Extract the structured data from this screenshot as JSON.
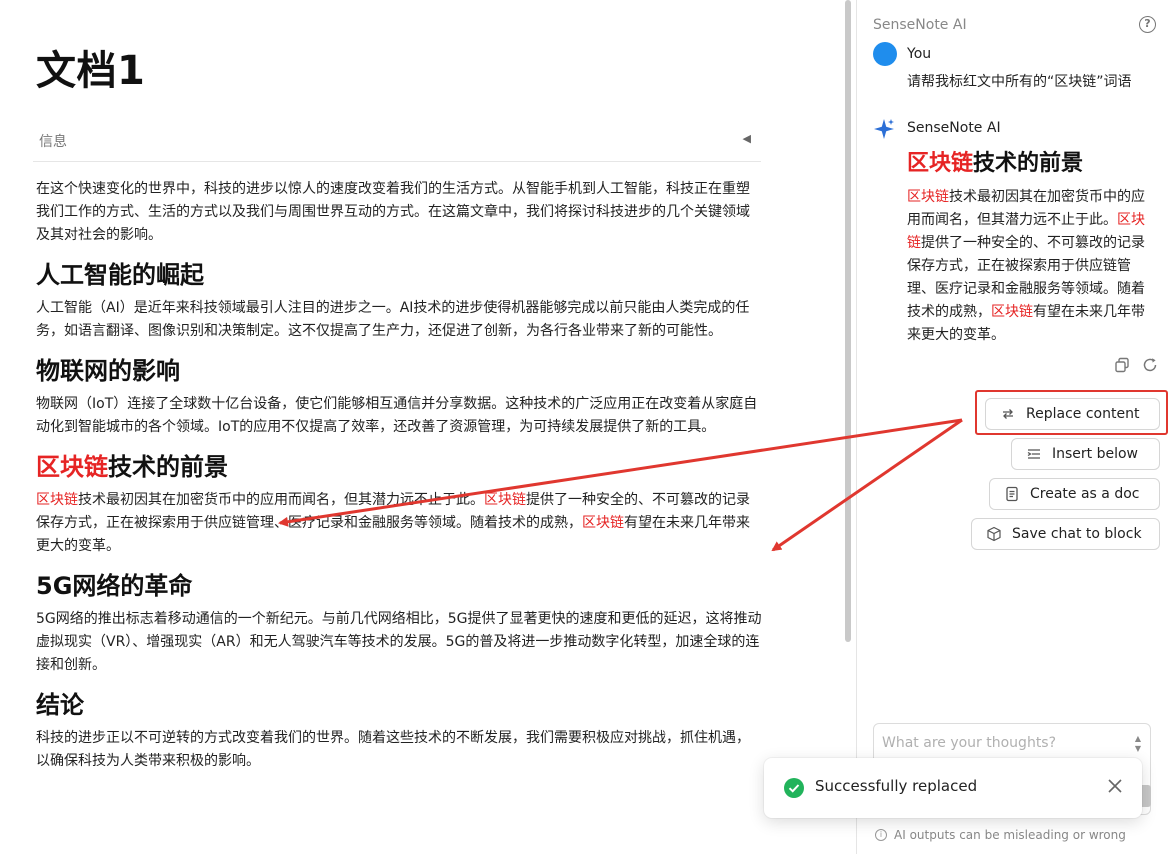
{
  "document": {
    "title": "文档1",
    "info_label": "信息",
    "intro": "在这个快速变化的世界中，科技的进步以惊人的速度改变着我们的生活方式。从智能手机到人工智能，科技正在重塑我们工作的方式、生活的方式以及我们与周围世界互动的方式。在这篇文章中，我们将探讨科技进步的几个关键领域及其对社会的影响。",
    "sections": [
      {
        "heading": "人工智能的崛起",
        "body": "人工智能（AI）是近年来科技领域最引人注目的进步之一。AI技术的进步使得机器能够完成以前只能由人类完成的任务，如语言翻译、图像识别和决策制定。这不仅提高了生产力，还促进了创新，为各行各业带来了新的可能性。"
      },
      {
        "heading": "物联网的影响",
        "body": "物联网（IoT）连接了全球数十亿台设备，使它们能够相互通信并分享数据。这种技术的广泛应用正在改变着从家庭自动化到智能城市的各个领域。IoT的应用不仅提高了效率，还改善了资源管理，为可持续发展提供了新的工具。"
      },
      {
        "heading_red": "区块链",
        "heading_rest": "技术的前景",
        "body_parts": [
          "区块链",
          "技术最初因其在加密货币中的应用而闻名，但其潜力远不止于此。",
          "区块链",
          "提供了一种安全的、不可篡改的记录保存方式，正在被探索用于供应链管理、医疗记录和金融服务等领域。随着技术的成熟，",
          "区块链",
          "有望在未来几年带来更大的变革。"
        ]
      },
      {
        "heading": "5G网络的革命",
        "body": "5G网络的推出标志着移动通信的一个新纪元。与前几代网络相比，5G提供了显著更快的速度和更低的延迟，这将推动虚拟现实（VR）、增强现实（AR）和无人驾驶汽车等技术的发展。5G的普及将进一步推动数字化转型，加速全球的连接和创新。"
      },
      {
        "heading": "结论",
        "body": "科技的进步正以不可逆转的方式改变着我们的世界。随着这些技术的不断发展，我们需要积极应对挑战，抓住机遇，以确保科技为人类带来积极的影响。"
      }
    ]
  },
  "panel": {
    "title": "SenseNote AI",
    "user_name": "You",
    "user_message": "请帮我标红文中所有的“区块链”词语",
    "ai_name": "SenseNote AI",
    "ai_heading_red": "区块链",
    "ai_heading_rest": "技术的前景",
    "ai_body_parts": [
      "区块链",
      "技术最初因其在加密货币中的应用而闻名，但其潜力远不止于此。",
      "区块链",
      "提供了一种安全的、不可篡改的记录保存方式，正在被探索用于供应链管理、医疗记录和金融服务等领域。随着技术的成熟，",
      "区块链",
      "有望在未来几年带来更大的变革。"
    ],
    "buttons": {
      "replace": "Replace content",
      "insert": "Insert below",
      "create": "Create as a doc",
      "save": "Save chat to block"
    },
    "input_placeholder": "What are your thoughts?",
    "disclaimer": "AI outputs can be misleading or wrong"
  },
  "toast": {
    "message": "Successfully replaced"
  },
  "colors": {
    "accent_red": "#e62424",
    "avatar_blue": "#1f8ded",
    "highlight_box": "#e0372f",
    "success_green": "#21b35b"
  }
}
